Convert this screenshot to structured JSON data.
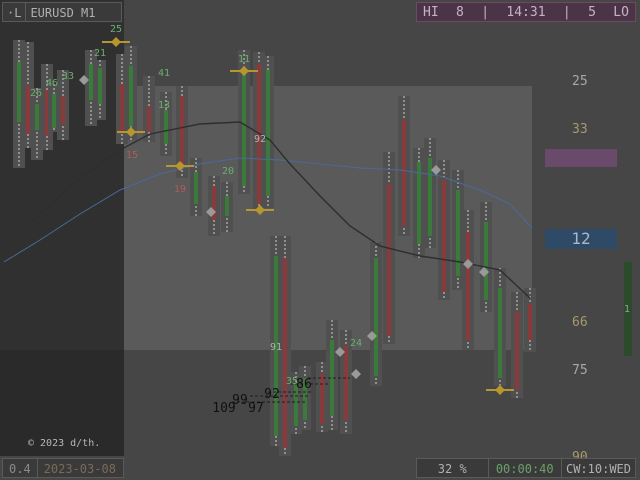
{
  "header": {
    "mode": "·L",
    "symbol": "EURUSD M1"
  },
  "status": {
    "hi_label": "HI",
    "hi_value": "8",
    "sep": "|",
    "time": "14:31",
    "lo_value": "5",
    "lo_label": "LO"
  },
  "price_scale": {
    "labels": [
      "25",
      "33",
      "66",
      "75",
      "90"
    ],
    "current": "12"
  },
  "right_indicator": "1",
  "footer": {
    "copyright": "© 2023 d/th.",
    "scale": "0.4",
    "date": "2023-03-08",
    "percent": "32 %",
    "timer": "00:00:40",
    "week": "CW:10:WED"
  },
  "colors": {
    "up": "#3a7a3a",
    "down": "#8a3a3a",
    "fast_ma": "#4a6a9a",
    "slow_ma": "#2e2e2e",
    "green_text": "#6ab06a",
    "red_text": "#b05a5a",
    "gold": "#b8962e",
    "panel_pink": "#4a3446",
    "price_box": "#2f4a66"
  },
  "chart_data": {
    "type": "candlestick",
    "bar_labels": [
      {
        "text": "25",
        "color": "#6ab06a"
      },
      {
        "text": "21",
        "color": "#6ab06a"
      },
      {
        "text": "33",
        "color": "#6ab06a"
      },
      {
        "text": "46",
        "color": "#6ab06a"
      },
      {
        "text": "26",
        "color": "#6ab06a"
      },
      {
        "text": "41",
        "color": "#6ab06a"
      },
      {
        "text": "13",
        "color": "#6ab06a"
      },
      {
        "text": "11",
        "color": "#6ab06a"
      },
      {
        "text": "92",
        "color": "#b0b0b0"
      },
      {
        "text": "20",
        "color": "#6ab06a"
      },
      {
        "text": "15",
        "color": "#b05a5a"
      },
      {
        "text": "19",
        "color": "#b05a5a"
      },
      {
        "text": "24",
        "color": "#6ab06a"
      },
      {
        "text": "35",
        "color": "#6ab06a"
      },
      {
        "text": "91",
        "color": "#b0b0b0"
      }
    ],
    "ladder_labels": [
      "86",
      "92",
      "99",
      "109",
      "97"
    ]
  }
}
